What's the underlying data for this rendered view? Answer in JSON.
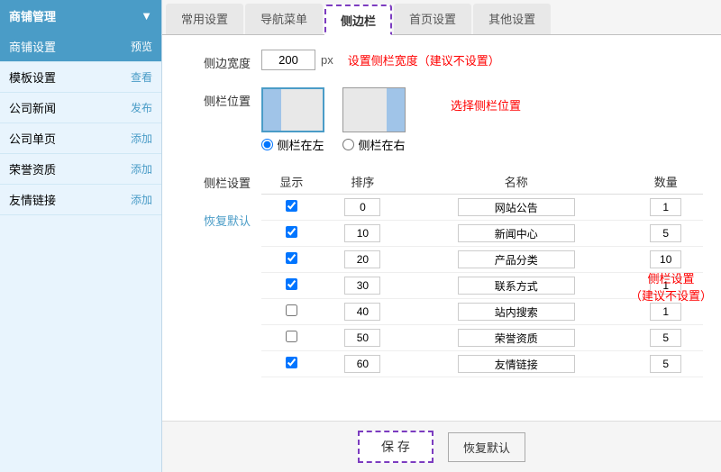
{
  "sidebar": {
    "header": "商铺管理",
    "arrow": "▼",
    "items": [
      {
        "label": "商铺设置",
        "action": "预览",
        "active": true
      },
      {
        "label": "模板设置",
        "action": "查看",
        "active": false
      },
      {
        "label": "公司新闻",
        "action": "发布",
        "active": false
      },
      {
        "label": "公司单页",
        "action": "添加",
        "active": false
      },
      {
        "label": "荣誉资质",
        "action": "添加",
        "active": false
      },
      {
        "label": "友情链接",
        "action": "添加",
        "active": false
      }
    ]
  },
  "tabs": [
    {
      "label": "常用设置",
      "active": false
    },
    {
      "label": "导航菜单",
      "active": false
    },
    {
      "label": "侧边栏",
      "active": true
    },
    {
      "label": "首页设置",
      "active": false
    },
    {
      "label": "其他设置",
      "active": false
    }
  ],
  "form": {
    "width_label": "侧边宽度",
    "width_value": "200",
    "width_unit": "px",
    "width_hint": "设置侧栏宽度（建议不设置）",
    "position_label": "侧栏位置",
    "position_left_label": "侧栏在左",
    "position_right_label": "侧栏在右",
    "position_hint": "选择侧栏位置",
    "sidebar_settings_label": "侧栏设置",
    "restore_link": "恢复默认",
    "right_hint_line1": "侧栏设置",
    "right_hint_line2": "（建议不设置）"
  },
  "table": {
    "headers": [
      "显示",
      "排序",
      "名称",
      "数量"
    ],
    "rows": [
      {
        "checked": true,
        "order": "0",
        "name": "网站公告",
        "qty": "1"
      },
      {
        "checked": true,
        "order": "10",
        "name": "新闻中心",
        "qty": "5"
      },
      {
        "checked": true,
        "order": "20",
        "name": "产品分类",
        "qty": "10"
      },
      {
        "checked": true,
        "order": "30",
        "name": "联系方式",
        "qty": "1"
      },
      {
        "checked": false,
        "order": "40",
        "name": "站内搜索",
        "qty": "1"
      },
      {
        "checked": false,
        "order": "50",
        "name": "荣誉资质",
        "qty": "5"
      },
      {
        "checked": true,
        "order": "60",
        "name": "友情链接",
        "qty": "5"
      }
    ]
  },
  "bottom": {
    "save_label": "保 存",
    "restore_label": "恢复默认"
  }
}
